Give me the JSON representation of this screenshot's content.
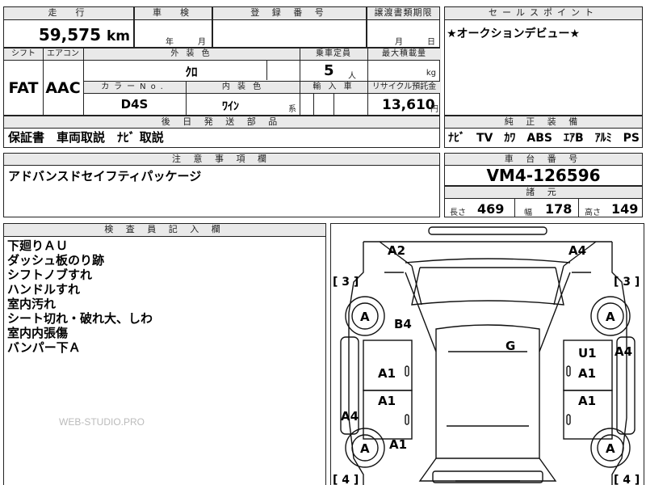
{
  "sheet": {
    "mileage": {
      "header": "走　行",
      "value": "59,575",
      "unit": "km"
    },
    "shaken": {
      "header": "車　検",
      "year_unit": "年",
      "month_unit": "月"
    },
    "registration": {
      "header": "登 録 番 号"
    },
    "transfer": {
      "header": "譲渡書類期限",
      "month_unit": "月",
      "day_unit": "日"
    },
    "shift": {
      "header": "シフト",
      "value": "FAT"
    },
    "aircon": {
      "header": "エアコン",
      "value": "AAC"
    },
    "exterior": {
      "header": "外 装 色",
      "value": "ｸﾛ"
    },
    "color_no": {
      "header": "カラーNo.",
      "value": "D4S"
    },
    "interior": {
      "header": "内 装 色",
      "value": "ﾜｲﾝ",
      "suffix": "系"
    },
    "capacity": {
      "header": "乗車定員",
      "value": "5",
      "unit": "人"
    },
    "max_load": {
      "header": "最大積載量",
      "unit": "kg"
    },
    "import": {
      "header": "輸 入 車"
    },
    "recycle": {
      "header": "リサイクル預託金",
      "value": "13,610",
      "unit": "円"
    },
    "shipping": {
      "header": "後 日 発 送 部 品",
      "value": "保証書　車両取説　ﾅﾋﾞ 取説"
    },
    "notes": {
      "header": "注 意 事 項 欄",
      "value": "アドバンスドセイフティパッケージ"
    },
    "sales_point": {
      "header": "セールスポイント",
      "value": "★オークションデビュー★"
    },
    "equipment": {
      "header": "純 正 装 備",
      "value": "ﾅﾋﾞ　TV　ｶﾜ　ABS　ｴｱB　ｱﾙﾐ　PS　PW"
    },
    "chassis": {
      "header": "車 台 番 号",
      "value": "VM4-126596"
    },
    "dimensions": {
      "header": "諸 元",
      "length_label": "長さ",
      "length": "469",
      "width_label": "幅",
      "width": "178",
      "height_label": "高さ",
      "height": "149"
    },
    "inspector": {
      "header": "検 査 員 記 入 欄",
      "lines": [
        "下廻りＡＵ",
        "ダッシュ板のり跡",
        "シフトノブすれ",
        "ハンドルすれ",
        "室内汚れ",
        "シート切れ・破れ大、しわ",
        "室内内張傷",
        "バンパー下Ａ"
      ]
    },
    "watermark": "WEB-STUDIO.PRO"
  },
  "diagram": {
    "marks": {
      "a2": "A2",
      "a4_top": "A4",
      "b4": "B4",
      "g": "G",
      "u1": "U1",
      "a4_right": "A4",
      "a1_lf": "A1",
      "a1_rf": "A1",
      "a1_lr": "A1",
      "a1_rr": "A1",
      "a4_left": "A4",
      "a1_rear": "A1",
      "wheel_lf": "A",
      "wheel_rf": "A",
      "wheel_lr": "A",
      "wheel_rr": "A",
      "tread_lf": "[ 3 ]",
      "tread_rf": "[ 3 ]",
      "tread_lr": "[ 4 ]",
      "tread_rr": "[ 4 ]"
    }
  }
}
